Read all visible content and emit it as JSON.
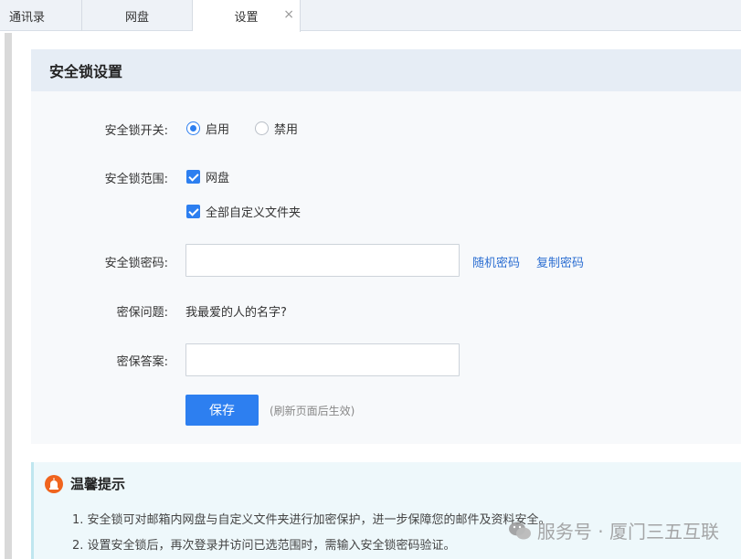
{
  "tabs": [
    {
      "label": "通讯录"
    },
    {
      "label": "网盘"
    },
    {
      "label": "设置",
      "active": true
    }
  ],
  "tab_close_glyph": "×",
  "panel": {
    "title": "安全锁设置",
    "switch": {
      "label": "安全锁开关:",
      "options": [
        "启用",
        "禁用"
      ],
      "selected": "启用"
    },
    "scope": {
      "label": "安全锁范围:",
      "options": [
        "网盘",
        "全部自定义文件夹"
      ],
      "checked": [
        "网盘",
        "全部自定义文件夹"
      ]
    },
    "password": {
      "label": "安全锁密码:",
      "value": "",
      "random_link": "随机密码",
      "copy_link": "复制密码"
    },
    "question": {
      "label": "密保问题:",
      "value": "我最爱的人的名字?"
    },
    "answer": {
      "label": "密保答案:",
      "value": ""
    },
    "save_label": "保存",
    "save_hint": "(刷新页面后生效)"
  },
  "tips": {
    "title": "温馨提示",
    "lines": [
      "1. 安全锁可对邮箱内网盘与自定义文件夹进行加密保护，进一步保障您的邮件及资料安全。",
      "2. 设置安全锁后，再次登录并访问已选范围时，需输入安全锁密码验证。"
    ]
  },
  "watermark": "服务号 · 厦门三五互联",
  "colors": {
    "accent": "#2d7ff0",
    "link": "#2d6fd2",
    "warn": "#f0641e"
  }
}
